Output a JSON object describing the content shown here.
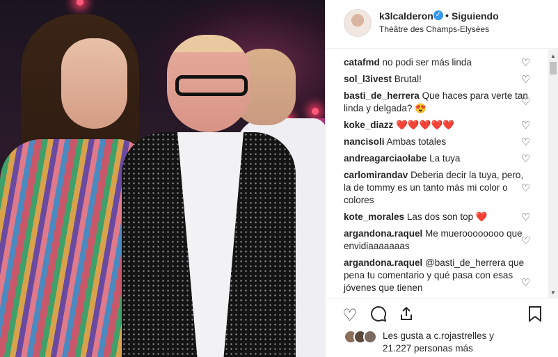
{
  "header": {
    "username": "k3lcalderon",
    "separator": "•",
    "follow_status": "Siguiendo",
    "location": "Théâtre des Champs-Elysées"
  },
  "comments": [
    {
      "user": "catafmd",
      "text": "no podi ser más linda"
    },
    {
      "user": "sol_l3ivest",
      "text": "Brutal!"
    },
    {
      "user": "basti_de_herrera",
      "text": "Que haces para verte tan linda y delgada? 😍"
    },
    {
      "user": "koke_diazz",
      "text": "❤️❤️❤️❤️❤️"
    },
    {
      "user": "nancisoli",
      "text": "Ambas totales"
    },
    {
      "user": "andreagarciaolabe",
      "text": "La tuya"
    },
    {
      "user": "carlomirandav",
      "text": "Deberia decir la tuya, pero, la de tommy es un tanto más mi color o colores"
    },
    {
      "user": "kote_morales",
      "text": "Las dos son top ❤️"
    },
    {
      "user": "argandona.raquel",
      "text": "Me mueroooooooo que envidiaaaaaaas"
    },
    {
      "user": "argandona.raquel",
      "text": "@basti_de_herrera que pena tu comentario y qué pasa con esas jóvenes que tienen"
    }
  ],
  "likes": {
    "line1": "Les gusta a c.rojastrelles y",
    "line2": "21.227 personas más"
  },
  "icons": {
    "heart": "heart-icon",
    "comment": "comment-icon",
    "share": "share-icon",
    "bookmark": "bookmark-icon",
    "verified": "verified-badge-icon"
  },
  "colors": {
    "verified": "#3897f0",
    "text": "#262626",
    "border": "#efefef"
  }
}
